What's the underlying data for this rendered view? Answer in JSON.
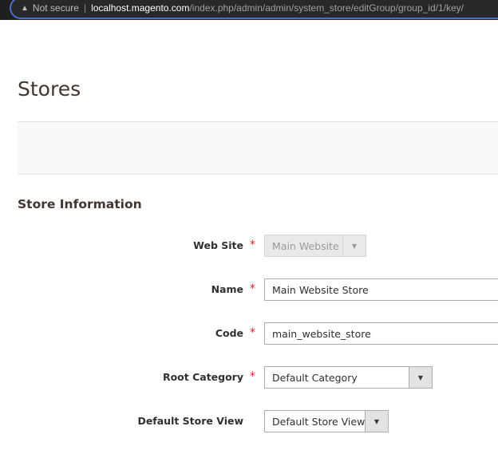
{
  "browser": {
    "security": "Not secure",
    "host": "localhost.magento.com",
    "path": "/index.php/admin/admin/system_store/editGroup/group_id/1/key/"
  },
  "page": {
    "title": "Stores",
    "section": "Store Information"
  },
  "form": {
    "website": {
      "label": "Web Site",
      "value": "Main Website",
      "required": true,
      "disabled": true
    },
    "name": {
      "label": "Name",
      "value": "Main Website Store",
      "required": true
    },
    "code": {
      "label": "Code",
      "value": "main_website_store",
      "required": true
    },
    "root_category": {
      "label": "Root Category",
      "value": "Default Category",
      "required": true
    },
    "default_store_view": {
      "label": "Default Store View",
      "value": "Default Store View",
      "required": false
    }
  },
  "req_mark": "*",
  "arrow": "▼"
}
